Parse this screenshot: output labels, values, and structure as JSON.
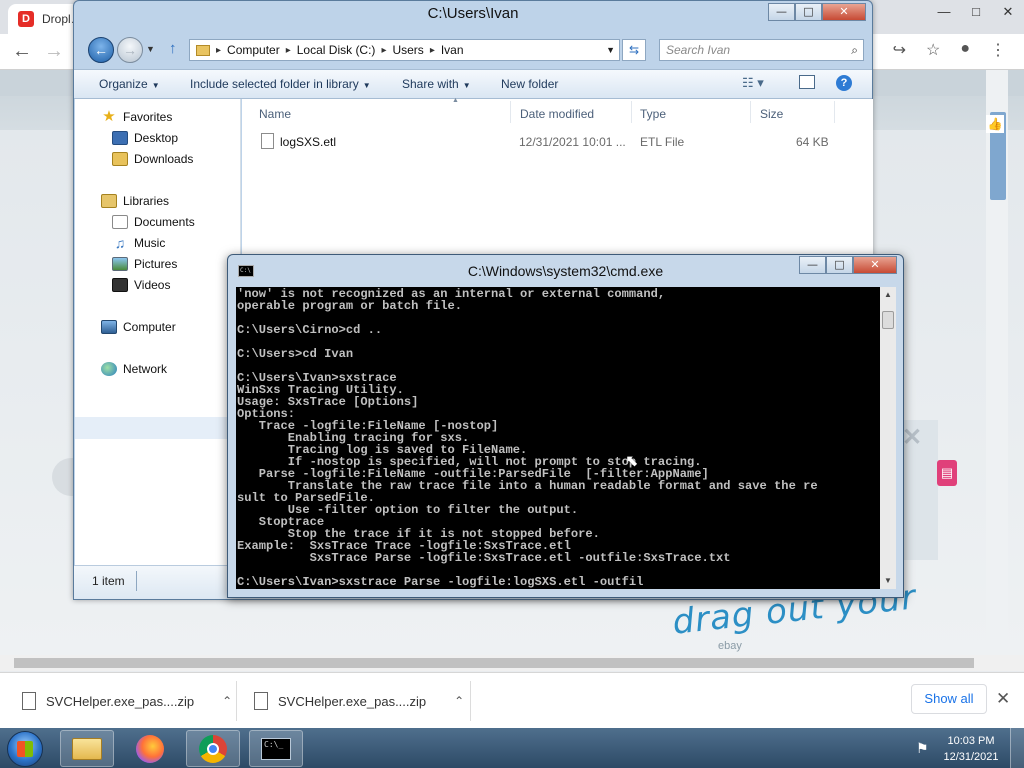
{
  "browser": {
    "tab_title": "Dropl…",
    "tab_favicon": "D",
    "window_buttons": [
      "—",
      "□",
      "✕"
    ],
    "nav": {
      "back": "←",
      "forward": "→"
    },
    "omnibox_icons": [
      "↪",
      "☆",
      "●",
      "⋮"
    ],
    "doodle_text": "drag out your",
    "doodle_sub": "ebay"
  },
  "downloads": {
    "items": [
      {
        "name": "SVCHelper.exe_pas....zip",
        "chevron": "⌃"
      },
      {
        "name": "SVCHelper.exe_pas....zip",
        "chevron": "⌃"
      }
    ],
    "show_all": "Show all",
    "close": "✕"
  },
  "explorer": {
    "title": "C:\\Users\\Ivan",
    "window_buttons": [
      "—",
      "□",
      "✕"
    ],
    "breadcrumb": [
      "Computer",
      "Local Disk (C:)",
      "Users",
      "Ivan"
    ],
    "search_placeholder": "Search Ivan",
    "toolbar": {
      "organize": "Organize",
      "include": "Include selected folder in library",
      "share": "Share with",
      "new_folder": "New folder"
    },
    "nav": {
      "favorites": "Favorites",
      "desktop": "Desktop",
      "downloads": "Downloads",
      "libraries": "Libraries",
      "documents": "Documents",
      "music": "Music",
      "pictures": "Pictures",
      "videos": "Videos",
      "computer": "Computer",
      "network": "Network"
    },
    "columns": {
      "name": "Name",
      "date": "Date modified",
      "type": "Type",
      "size": "Size"
    },
    "files": [
      {
        "name": "logSXS.etl",
        "date": "12/31/2021 10:01 ...",
        "type": "ETL File",
        "size": "64 KB"
      }
    ],
    "status": "1 item"
  },
  "cmd": {
    "title": "C:\\Windows\\system32\\cmd.exe",
    "window_buttons": [
      "—",
      "□",
      "✕"
    ],
    "lines": [
      "'now' is not recognized as an internal or external command,",
      "operable program or batch file.",
      "",
      "C:\\Users\\Cirno>cd ..",
      "",
      "C:\\Users>cd Ivan",
      "",
      "C:\\Users\\Ivan>sxstrace",
      "WinSxs Tracing Utility.",
      "Usage: SxsTrace [Options]",
      "Options:",
      "   Trace -logfile:FileName [-nostop]",
      "       Enabling tracing for sxs.",
      "       Tracing log is saved to FileName.",
      "       If -nostop is specified, will not prompt to stop tracing.",
      "   Parse -logfile:FileName -outfile:ParsedFile  [-filter:AppName]",
      "       Translate the raw trace file into a human readable format and save the re",
      "sult to ParsedFile.",
      "       Use -filter option to filter the output.",
      "   Stoptrace",
      "       Stop the trace if it is not stopped before.",
      "Example:  SxsTrace Trace -logfile:SxsTrace.etl",
      "          SxsTrace Parse -logfile:SxsTrace.etl -outfile:SxsTrace.txt",
      "",
      "C:\\Users\\Ivan>sxstrace Parse -logfile:logSXS.etl -outfil"
    ]
  },
  "taskbar": {
    "clock_time": "10:03 PM",
    "clock_date": "12/31/2021"
  },
  "icons": {
    "back": "back-arrow-icon",
    "forward": "forward-arrow-icon",
    "up": "up-arrow-icon",
    "search": "search-icon",
    "help": "help-icon"
  }
}
